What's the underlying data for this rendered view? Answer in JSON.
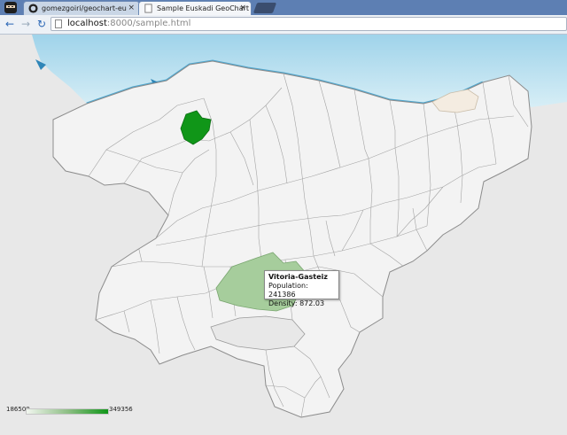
{
  "browser": {
    "tabs": [
      {
        "title": "gomezgoiri/geochart-eu",
        "active": false,
        "icon": "github-icon",
        "close": "×"
      },
      {
        "title": "Sample Euskadi GeoChart",
        "active": true,
        "icon": "page-icon",
        "close": "×"
      }
    ],
    "nav": {
      "back": "←",
      "forward": "→",
      "reload": "↻"
    },
    "url_host": "localhost",
    "url_rest": ":8000/sample.html"
  },
  "colors": {
    "sea": "#bfe3ef",
    "region_fill": "#f3f3f3",
    "region_stroke": "#9a9a9a",
    "highlight_high": "#109618",
    "highlight_mid": "#a6cd9c",
    "highlight_low": "#f4ece1"
  },
  "chart_data": {
    "type": "geo",
    "region": "Euskadi",
    "color_axis": {
      "min": 186500,
      "max": 349356,
      "min_label": "186500",
      "max_label": "349356"
    },
    "highlighted": [
      {
        "name": "Vitoria-Gasteiz",
        "population": 241386,
        "density": 872.03,
        "color": "#a6cd9c"
      }
    ],
    "tooltip": {
      "title": "Vitoria-Gasteiz",
      "line1": "Population: 241386",
      "line2": "Density: 872.03"
    }
  }
}
